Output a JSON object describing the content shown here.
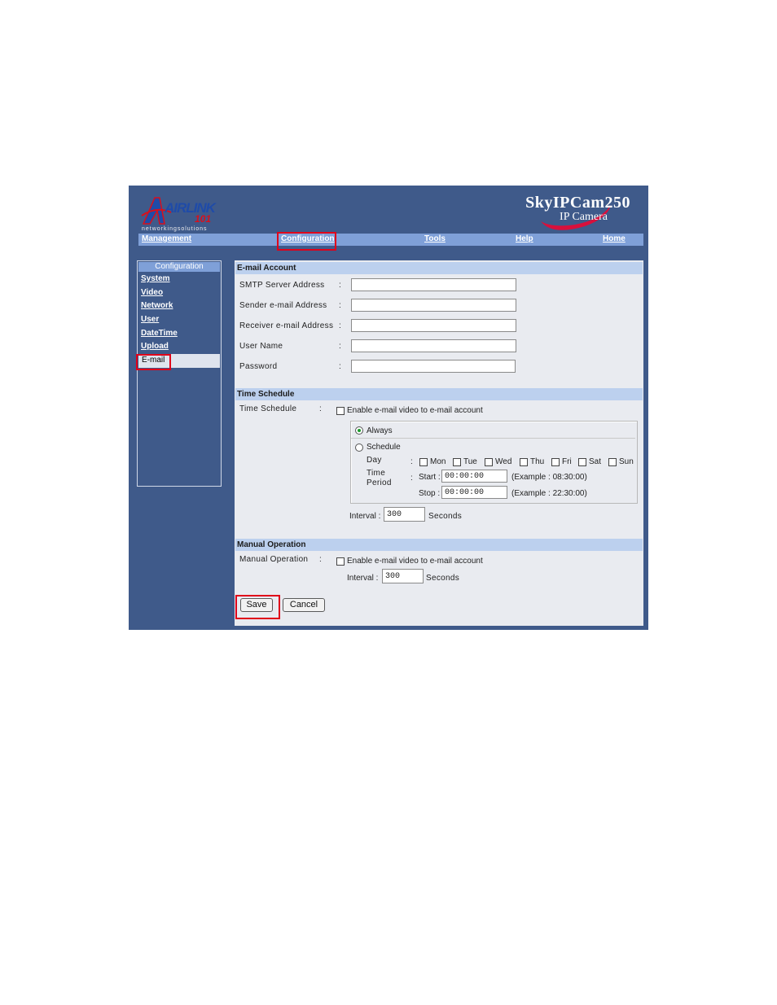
{
  "header": {
    "brand": "AIRLINK",
    "brand_number": "101",
    "brand_tagline": "networkingsolutions",
    "product_name": "SkyIPCam250",
    "product_subtitle": "IP Camera"
  },
  "topnav": [
    "Management",
    "Configuration",
    "Tools",
    "Help",
    "Home"
  ],
  "sidebar": {
    "heading": "Configuration",
    "items": [
      "System",
      "Video",
      "Network",
      "User",
      "DateTime",
      "Upload",
      "E-mail"
    ],
    "active": "E-mail"
  },
  "email_account": {
    "title": "E-mail Account",
    "colon": ":",
    "fields": [
      {
        "label": "SMTP Server Address",
        "value": ""
      },
      {
        "label": "Sender e-mail Address",
        "value": ""
      },
      {
        "label": "Receiver e-mail Address",
        "value": ""
      },
      {
        "label": "User Name",
        "value": ""
      },
      {
        "label": "Password",
        "value": ""
      }
    ]
  },
  "time_schedule": {
    "title": "Time Schedule",
    "label": "Time Schedule",
    "colon": ":",
    "enable_label": "Enable e-mail video to e-mail account",
    "enable_checked": false,
    "always_label": "Always",
    "schedule_label": "Schedule",
    "selected_mode": "Always",
    "day_label": "Day",
    "days": [
      "Mon",
      "Tue",
      "Wed",
      "Thu",
      "Fri",
      "Sat",
      "Sun"
    ],
    "time_label_1": "Time",
    "time_label_2": "Period",
    "start_label": "Start :",
    "stop_label": "Stop :",
    "start_value": "00:00:00",
    "stop_value": "00:00:00",
    "start_example": "(Example : 08:30:00)",
    "stop_example": "(Example : 22:30:00)",
    "interval_label": "Interval :",
    "interval_value": "300",
    "interval_unit": "Seconds"
  },
  "manual_operation": {
    "title": "Manual Operation",
    "label": "Manual Operation",
    "colon": ":",
    "enable_label": "Enable e-mail video to e-mail account",
    "enable_checked": false,
    "interval_label": "Interval :",
    "interval_value": "300",
    "interval_unit": "Seconds"
  },
  "buttons": {
    "save": "Save",
    "cancel": "Cancel"
  },
  "colors": {
    "frame_bg": "#3f5a8a",
    "nav_bar": "#7fa0d8",
    "section_header": "#bcd0ee",
    "content_bg": "#e9ebf0",
    "highlight": "#e0001a"
  }
}
